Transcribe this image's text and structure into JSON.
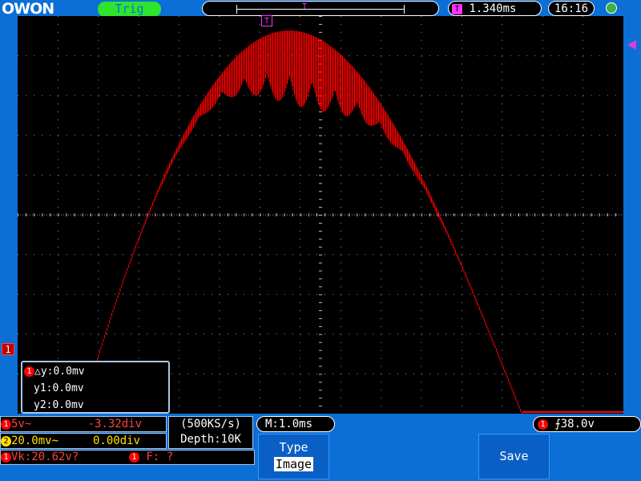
{
  "brand": "OWON",
  "trigger_status": "Trig",
  "time_offset": "1.340ms",
  "clock": "16:16",
  "trigger_position_marker": "T",
  "ch1_marker": "1",
  "cursor": {
    "channel": "1",
    "delta_y": "△y:0.0mv",
    "y1": "y1:0.0mv",
    "y2": "y2:0.0mv"
  },
  "ch1": {
    "channel": "1",
    "scale": "5v~",
    "position": "-3.32div"
  },
  "ch2": {
    "channel": "2",
    "scale": "20.0mv~",
    "position": "0.00div"
  },
  "sample_rate": "(500KS/s)",
  "depth": "Depth:10K",
  "timebase": "M:1.0ms",
  "trigger_level": {
    "channel": "1",
    "edge_symbol": "⨍",
    "value": "38.0v"
  },
  "measurements": {
    "vk_channel": "1",
    "vk": "Vk:20.62v?",
    "f_channel": "1",
    "f": "F:  ?"
  },
  "menu": {
    "type_label": "Type",
    "type_value": "Image",
    "save_label": "Save"
  },
  "colors": {
    "ch1": "#ff0000",
    "ch2": "#ffe000",
    "trigger": "#ff33ff",
    "bezel": "#0b6fd6"
  },
  "icons": {
    "usb": "usb-icon"
  }
}
